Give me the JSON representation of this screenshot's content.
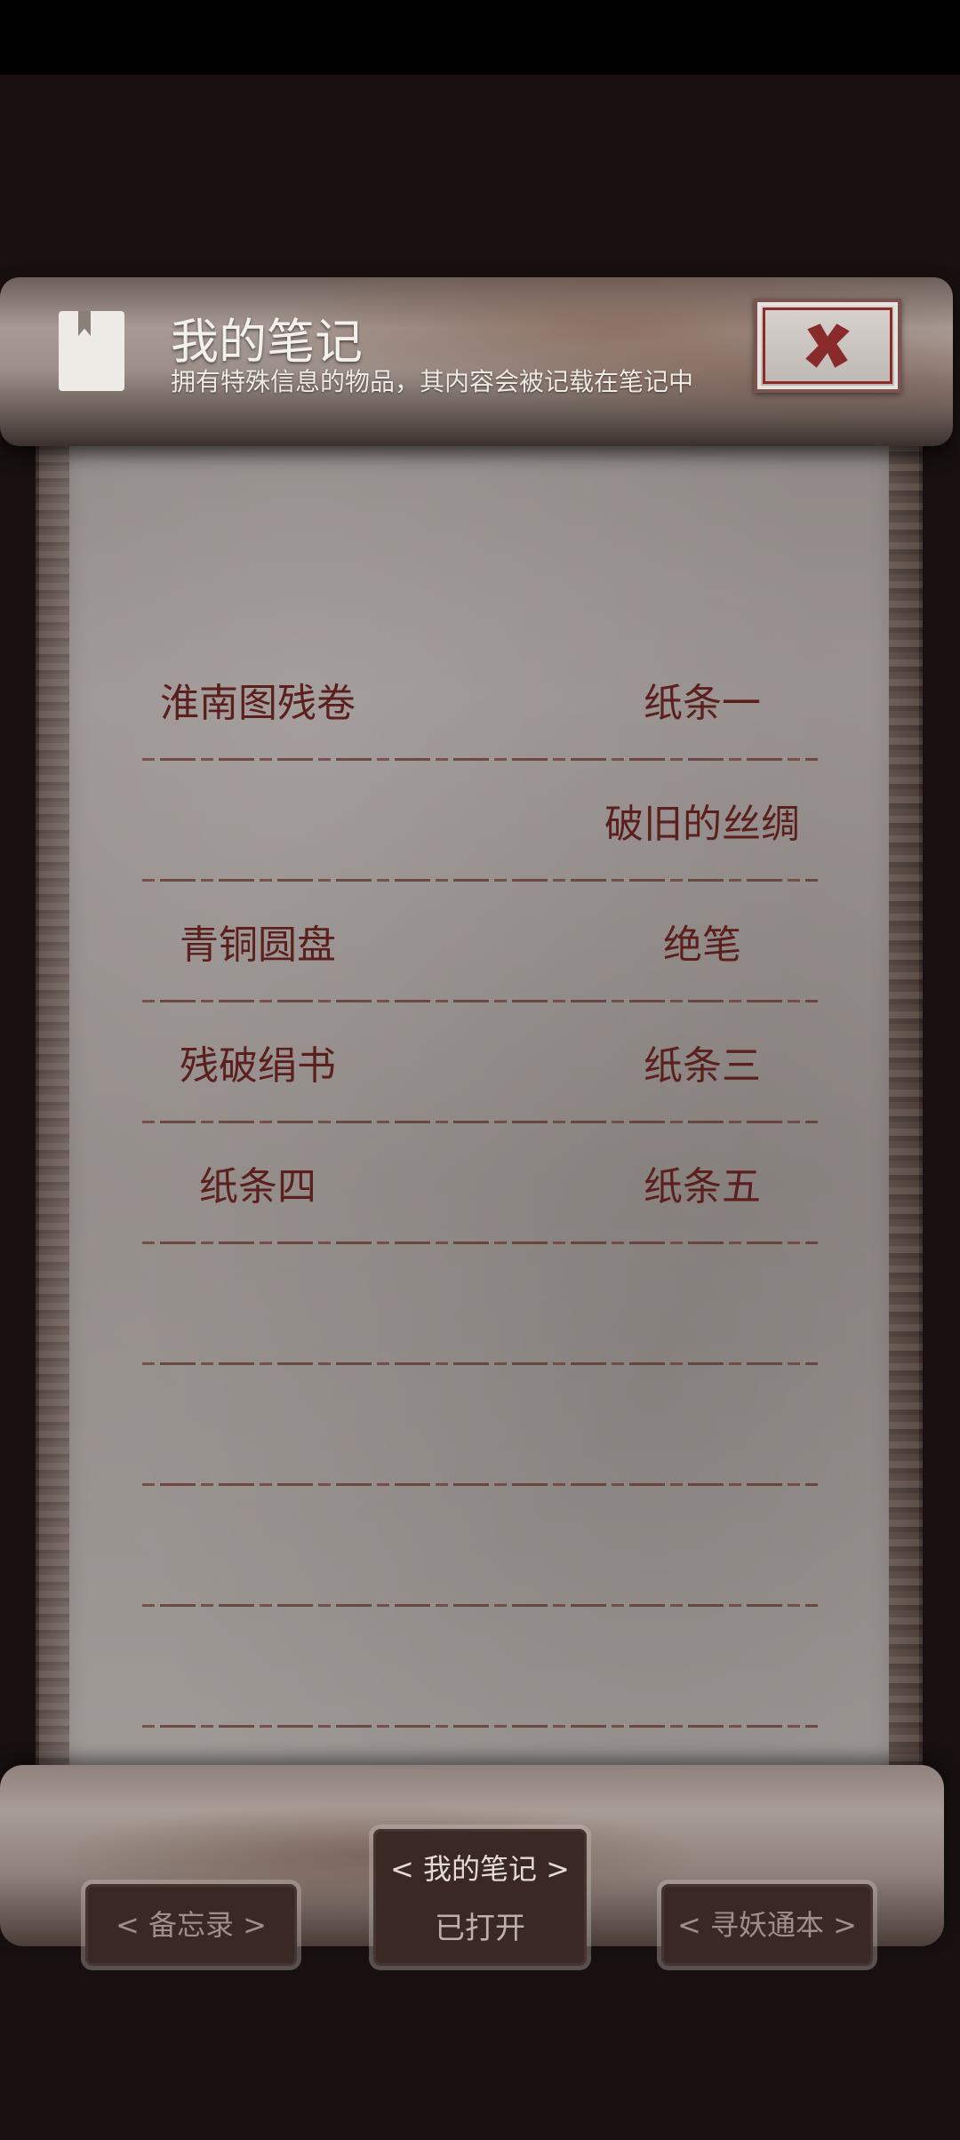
{
  "header": {
    "title": "我的笔记",
    "subtitle": "拥有特殊信息的物品，其内容会被记载在笔记中",
    "icons": {
      "notebook": "notebook-icon",
      "close": "close-icon"
    }
  },
  "notes": {
    "rows": [
      {
        "left": "淮南图残卷",
        "right": "纸条一"
      },
      {
        "left": "",
        "right": "破旧的丝绸"
      },
      {
        "left": "青铜圆盘",
        "right": "绝笔"
      },
      {
        "left": "残破绢书",
        "right": "纸条三"
      },
      {
        "left": "纸条四",
        "right": "纸条五"
      },
      {
        "left": "",
        "right": ""
      },
      {
        "left": "",
        "right": ""
      },
      {
        "left": "",
        "right": ""
      },
      {
        "left": "",
        "right": ""
      }
    ]
  },
  "tabs": {
    "memo": "< 备忘录 >",
    "notes": "< 我的笔记 >",
    "notes_status": "已打开",
    "bestiary": "< 寻妖通本 >"
  },
  "colors": {
    "ink": "#5b1f1d",
    "paper": "#9a9391",
    "close_red": "#8a2b2b"
  }
}
